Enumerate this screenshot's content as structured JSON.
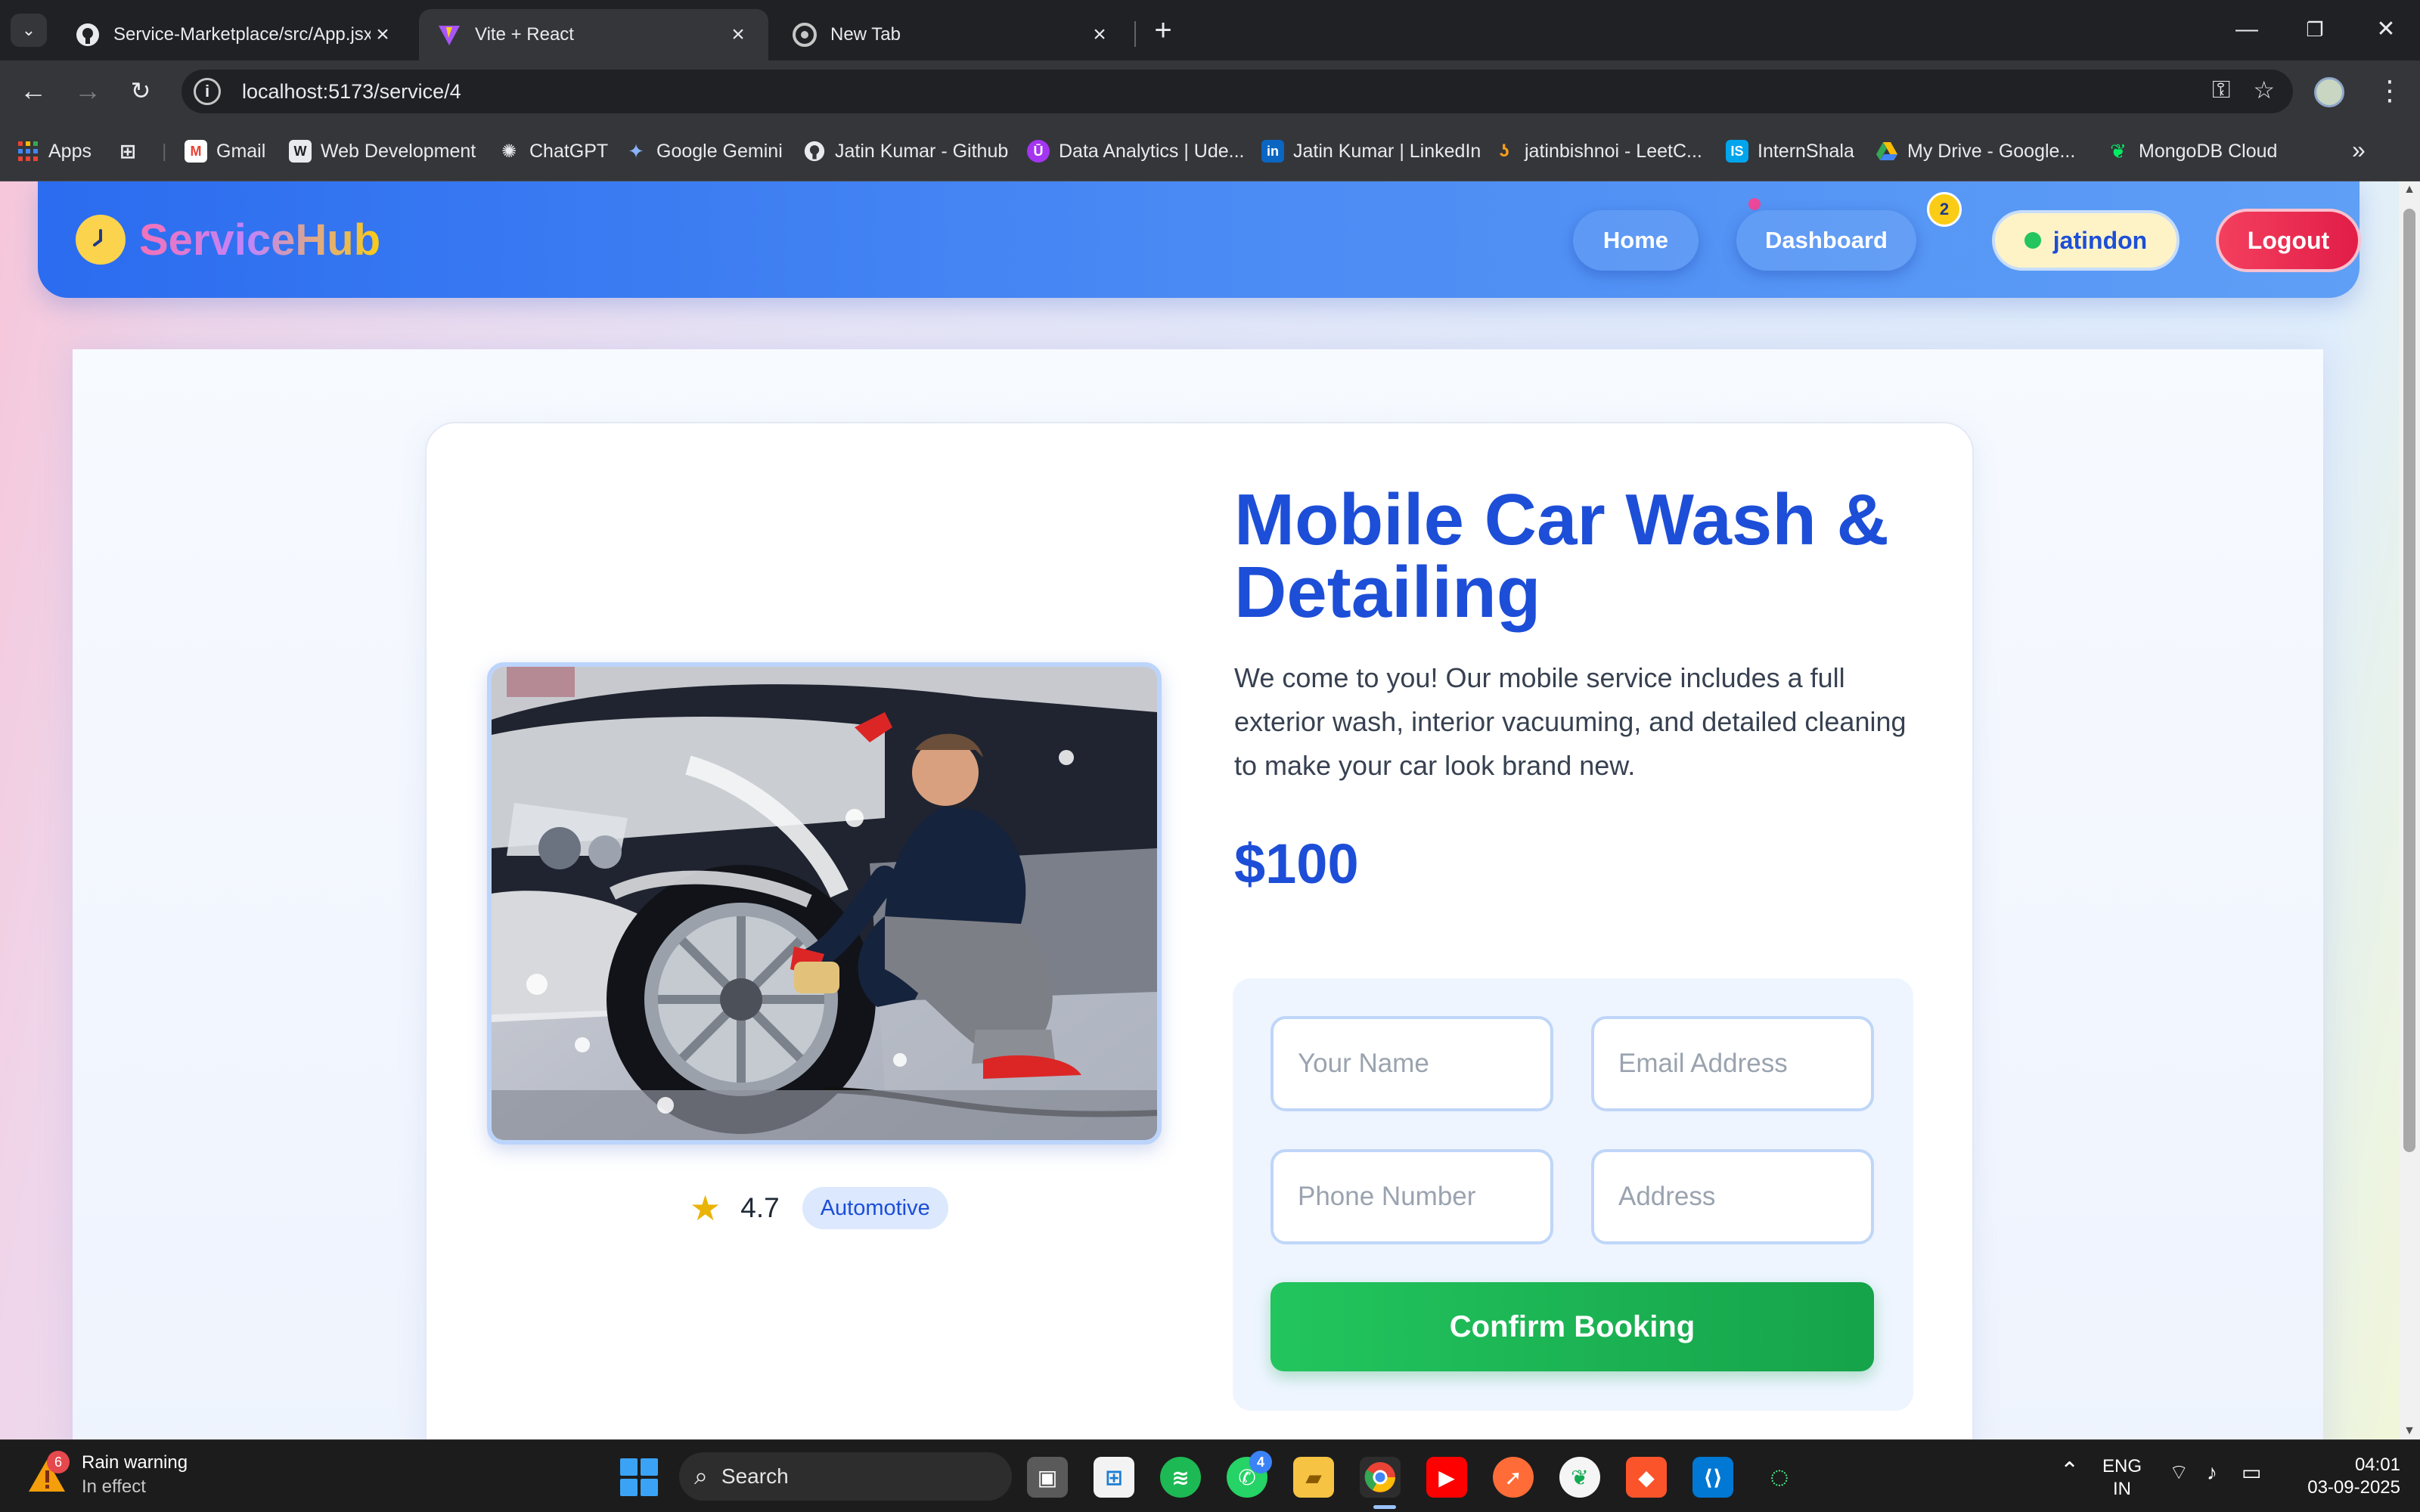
{
  "browser": {
    "tabs": [
      {
        "title": "Service-Marketplace/src/App.jsx",
        "icon": "github-icon"
      },
      {
        "title": "Vite + React",
        "icon": "vite-icon"
      },
      {
        "title": "New Tab",
        "icon": "chrome-icon"
      }
    ],
    "url": "localhost:5173/service/4",
    "bookmarks": [
      {
        "label": "Apps"
      },
      {
        "label": ""
      },
      {
        "label": "Gmail"
      },
      {
        "label": "Web Development"
      },
      {
        "label": "ChatGPT"
      },
      {
        "label": "Google Gemini"
      },
      {
        "label": "Jatin Kumar - Github"
      },
      {
        "label": "Data Analytics | Ude..."
      },
      {
        "label": "Jatin Kumar | LinkedIn"
      },
      {
        "label": "jatinbishnoi - LeetC..."
      },
      {
        "label": "InternShala"
      },
      {
        "label": "My Drive - Google..."
      },
      {
        "label": "MongoDB Cloud"
      }
    ]
  },
  "app": {
    "brand": "ServiceHub",
    "nav": {
      "home": "Home",
      "dashboard": "Dashboard",
      "dashboard_badge": "2",
      "username": "jatindon",
      "logout": "Logout"
    }
  },
  "service": {
    "title": "Mobile Car Wash & Detailing",
    "description": "We come to you! Our mobile service includes a full exterior wash, interior vacuuming, and detailed cleaning to make your car look brand new.",
    "price": "$100",
    "rating": "4.7",
    "category": "Automotive"
  },
  "booking_form": {
    "name_placeholder": "Your Name",
    "email_placeholder": "Email Address",
    "phone_placeholder": "Phone Number",
    "address_placeholder": "Address",
    "submit_label": "Confirm Booking"
  },
  "taskbar": {
    "weather_title": "Rain warning",
    "weather_sub": "In effect",
    "weather_badge": "6",
    "search_label": "Search",
    "whatsapp_badge": "4",
    "lang_top": "ENG",
    "lang_bottom": "IN",
    "time": "04:01",
    "date": "03-09-2025"
  },
  "colors": {
    "brand_blue": "#1d4ed8",
    "nav_gradient_start": "#2b6cf0",
    "confirm_green": "#22c55e",
    "logout_red": "#f43f5e"
  }
}
